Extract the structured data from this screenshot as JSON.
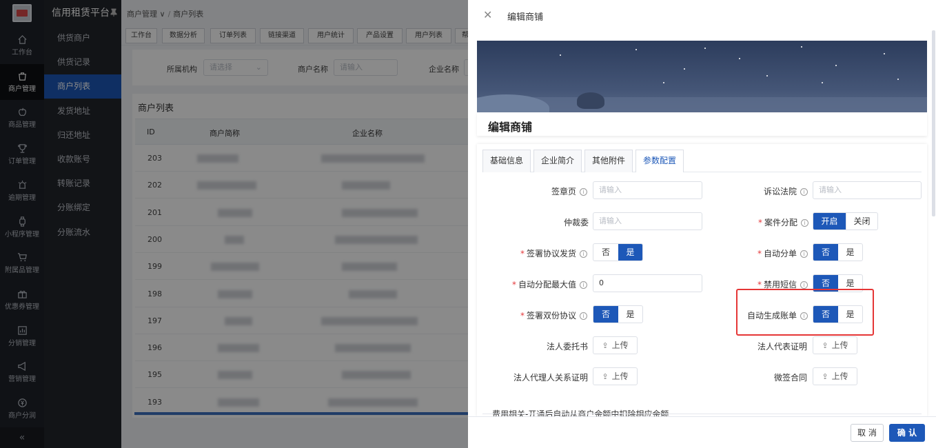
{
  "app": {
    "title": "信用租赁平台"
  },
  "nav_primary": [
    {
      "label": "工作台",
      "icon": "home-icon"
    },
    {
      "label": "商户管理",
      "icon": "bag-icon",
      "active": true
    },
    {
      "label": "商品管理",
      "icon": "apple-icon"
    },
    {
      "label": "订单管理",
      "icon": "trophy-icon"
    },
    {
      "label": "逾期管理",
      "icon": "alarm-icon"
    },
    {
      "label": "小程序管理",
      "icon": "watch-icon"
    },
    {
      "label": "附属品管理",
      "icon": "cart-icon"
    },
    {
      "label": "优惠券管理",
      "icon": "gift-icon"
    },
    {
      "label": "分销管理",
      "icon": "chart-icon"
    },
    {
      "label": "营销管理",
      "icon": "megaphone-icon"
    },
    {
      "label": "商户分润",
      "icon": "coin-icon"
    }
  ],
  "nav_secondary": [
    {
      "label": "供货商户"
    },
    {
      "label": "供货记录"
    },
    {
      "label": "商户列表",
      "active": true
    },
    {
      "label": "发货地址"
    },
    {
      "label": "归还地址"
    },
    {
      "label": "收款账号"
    },
    {
      "label": "转账记录"
    },
    {
      "label": "分账绑定"
    },
    {
      "label": "分账流水"
    }
  ],
  "breadcrumb": {
    "first": "商户管理 ∨",
    "sep": "/",
    "second": "商户列表"
  },
  "top_tabs": [
    "工作台",
    "数据分析",
    "订单列表",
    "链接渠道",
    "用户统计",
    "产品设置",
    "用户列表",
    "帮"
  ],
  "filter": {
    "org_label": "所属机构",
    "org_placeholder": "请选择",
    "merchant_label": "商户名称",
    "merchant_placeholder": "请输入",
    "company_label": "企业名称"
  },
  "list": {
    "title": "商户列表",
    "columns": [
      "ID",
      "商户简称",
      "企业名称"
    ],
    "rows": [
      "203",
      "202",
      "201",
      "200",
      "199",
      "198",
      "197",
      "196",
      "195",
      "193"
    ]
  },
  "drawer": {
    "title": "编辑商铺",
    "card_title": "编辑商铺",
    "tabs": [
      "基础信息",
      "企业简介",
      "其他附件",
      "参数配置"
    ],
    "active_tab": 3,
    "fields": {
      "sign_page": {
        "label": "签章页",
        "placeholder": "请输入"
      },
      "court": {
        "label": "诉讼法院",
        "placeholder": "请输入"
      },
      "arbitration": {
        "label": "仲裁委",
        "placeholder": "请输入"
      },
      "case_assign": {
        "label": "案件分配",
        "on": "开启",
        "off": "关闭",
        "selected": "开启"
      },
      "sign_ship": {
        "label": "签署协议发货",
        "no": "否",
        "yes": "是",
        "selected": "是"
      },
      "auto_assign": {
        "label": "自动分单",
        "no": "否",
        "yes": "是",
        "selected": "否"
      },
      "auto_max": {
        "label": "自动分配最大值",
        "value": "0"
      },
      "disable_sms": {
        "label": "禁用短信",
        "no": "否",
        "yes": "是",
        "selected": "否"
      },
      "sign_double": {
        "label": "签署双份协议",
        "no": "否",
        "yes": "是",
        "selected": "否"
      },
      "auto_bill": {
        "label": "自动生成账单",
        "no": "否",
        "yes": "是",
        "selected": "否"
      },
      "legal_entrust": {
        "label": "法人委托书",
        "button": "上传"
      },
      "legal_proof": {
        "label": "法人代表证明",
        "button": "上传"
      },
      "legal_agent": {
        "label": "法人代理人关系证明",
        "button": "上传"
      },
      "weisign": {
        "label": "微签合同",
        "button": "上传"
      }
    },
    "fee_note": "费用相关-开通后自动从商户余额中扣除相应余额",
    "cancel": "取 消",
    "confirm": "确 认"
  }
}
